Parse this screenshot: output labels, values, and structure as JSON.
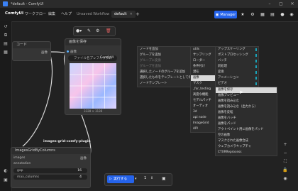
{
  "window": {
    "title": "*default - ComfyUI"
  },
  "menubar": {
    "brand": "ComfyUI",
    "menus": [
      "ワークフロー",
      "編集",
      "ヘルプ"
    ],
    "tabs": [
      {
        "label": "Unsaved Workflow",
        "active": false
      },
      {
        "label": "default",
        "active": true
      }
    ],
    "add_tab": "+",
    "manager_label": "Manager"
  },
  "nodes": {
    "left_title": "コード",
    "left_output": "画像",
    "save_title": "画像を保存",
    "save_input": "画像",
    "save_prefix_label": "ファイル名プレフィックス",
    "save_prefix_value": "ComfyUI",
    "save_caption": "3328 × 3136",
    "plugin_label": "images-grid-comfy-plugin",
    "grid_title": "ImagesGridByColumns",
    "grid_input_images": "images",
    "grid_input_annotation": "annotation",
    "grid_output": "画像",
    "grid_gap_label": "gap",
    "grid_gap_value": "16",
    "grid_max_label": "max_columns",
    "grid_max_value": "4"
  },
  "context_menu": {
    "main": [
      "ノードを追加",
      "グループを追加",
      "グループに変換",
      "グループを追加",
      "選択したノードのグループを追加",
      "選択したものをテンプレートとして保存",
      "ノードテンプレート"
    ],
    "main_disabled": [
      false,
      false,
      true,
      true,
      false,
      false,
      false
    ],
    "categories": [
      "utils",
      "サンプリング",
      "ローダー",
      "条件付け",
      "潜在",
      "画像",
      "マスク",
      "_for_testing",
      "高度な機能",
      "モデルパッチ",
      "オーディオ",
      "3d",
      "api node",
      "ImageGrid",
      "API"
    ],
    "image_sub": [
      "アップスケーリング",
      "ポストプロセッシング",
      "バッチ",
      "前処理",
      "変換",
      "アニメーション",
      "ビデオ"
    ],
    "image_nodes": [
      "画像を保存",
      "画像プレビュー",
      "画像を読み込む",
      "画像を読み込む（出力から）",
      "画像を反転",
      "画像をバッチ",
      "画像をパッド",
      "アウトペイント用に画像をパッド",
      "空の画像",
      "マスクされた画像合成",
      "ウェブカメラキャプチャ",
      "CTXRReprocess"
    ]
  },
  "runbar": {
    "run_label": "実行する",
    "count": "1"
  },
  "colors": {
    "accent": "#2563eb",
    "highlight": "#1aa3b8"
  }
}
